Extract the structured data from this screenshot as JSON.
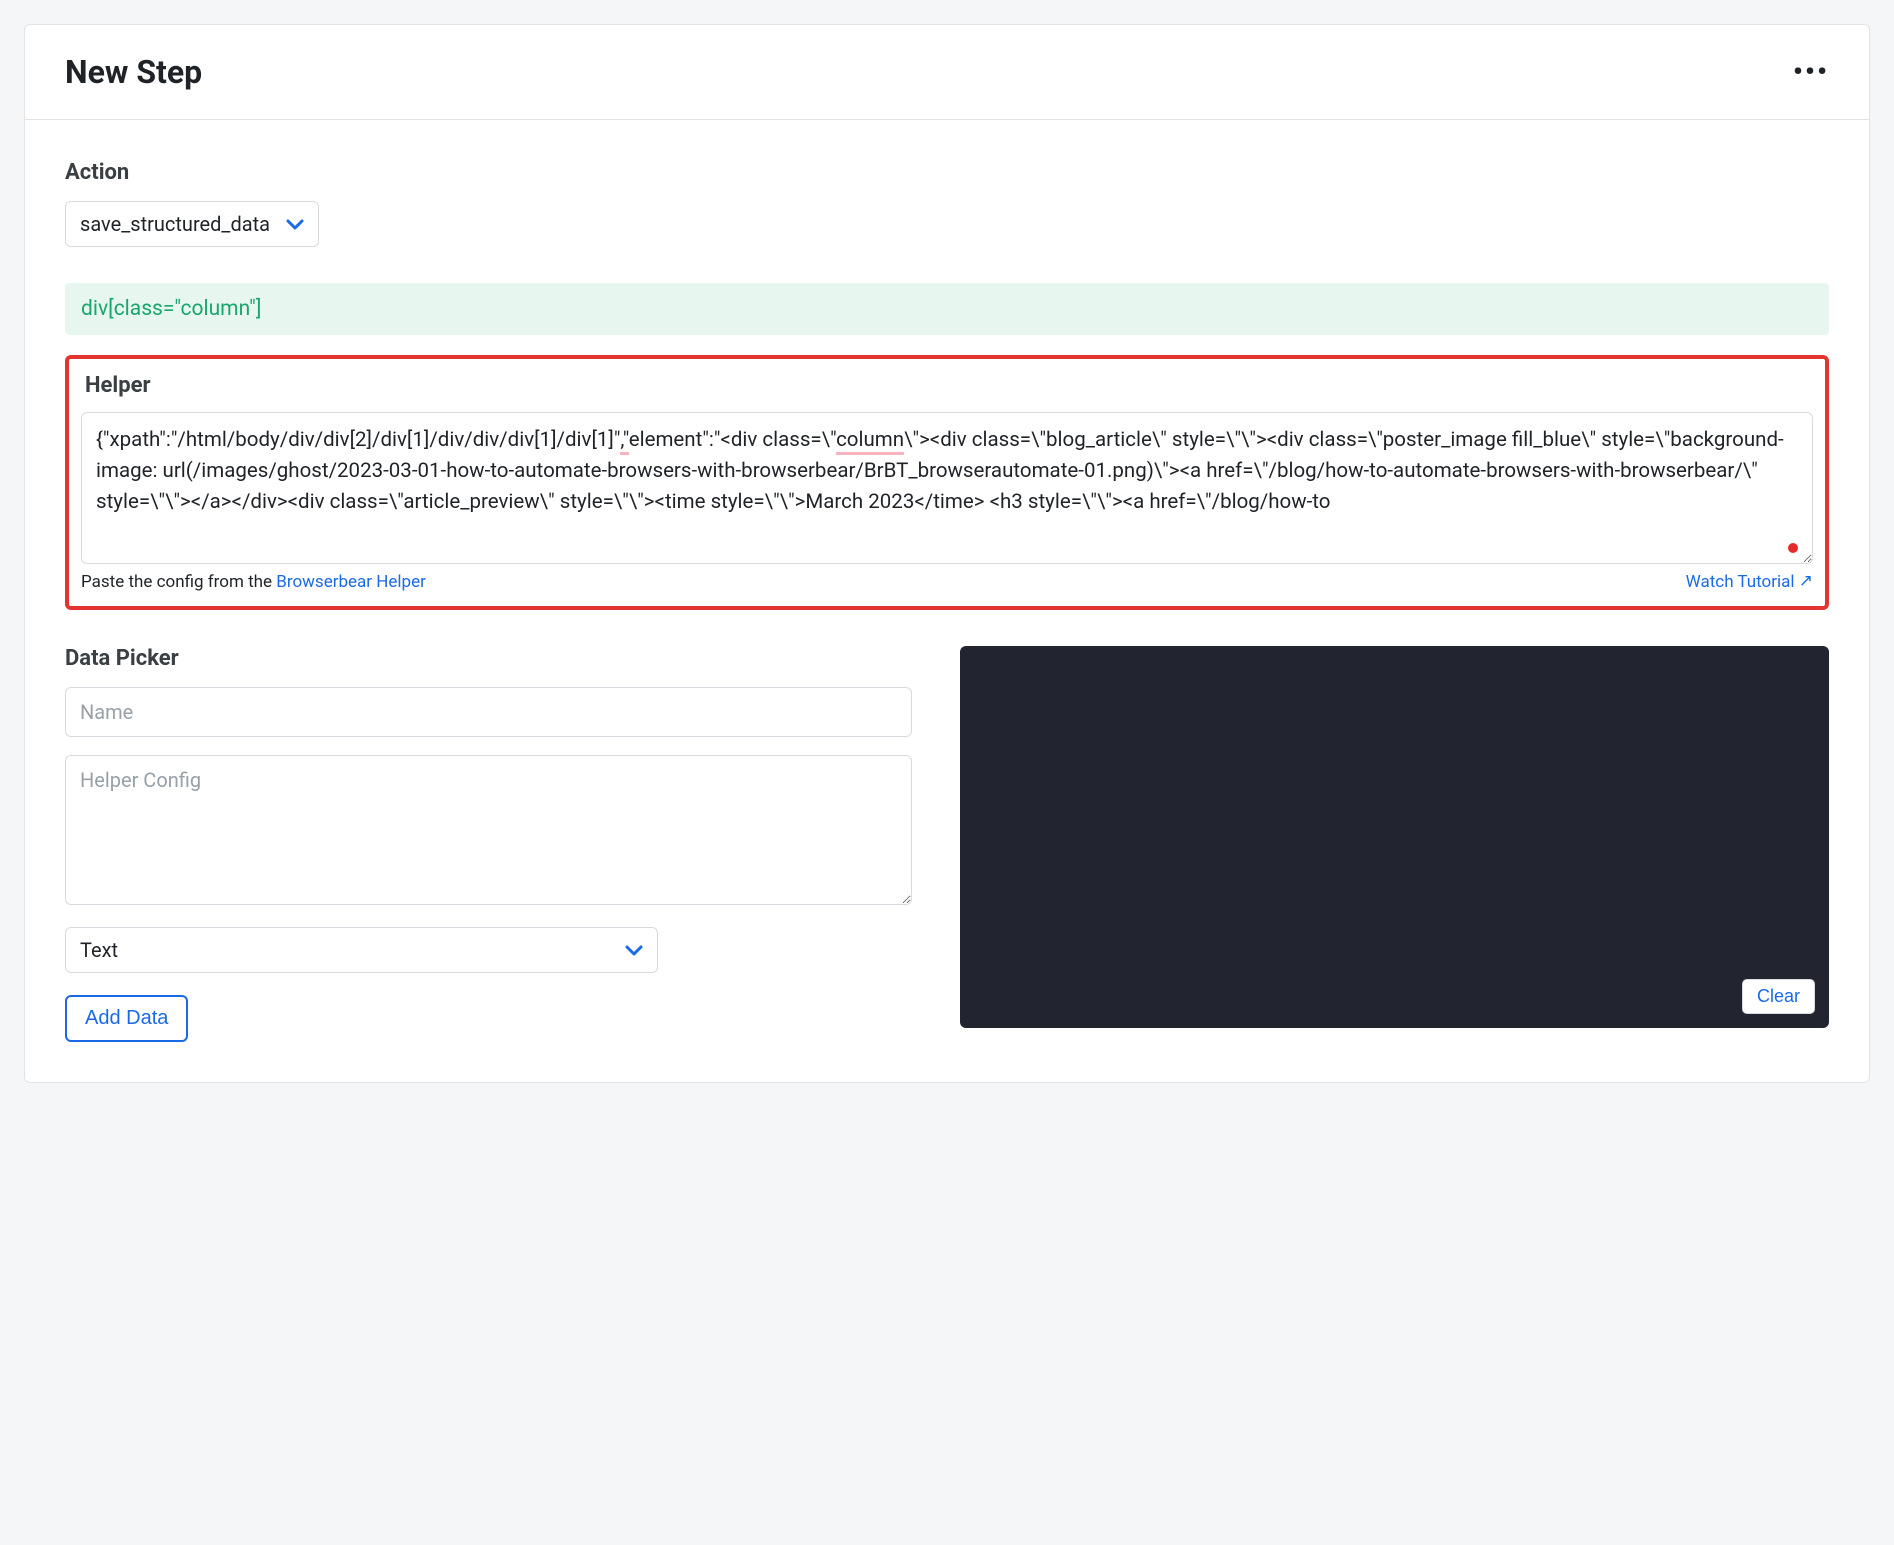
{
  "header": {
    "title": "New Step"
  },
  "action": {
    "label": "Action",
    "value": "save_structured_data"
  },
  "selector_chip": "div[class=\"column\"]",
  "helper": {
    "label": "Helper",
    "value": "{\"xpath\":\"/html/body/div/div[2]/div[1]/div/div/div[1]/div[1]\",\"element\":\"<div class=\\\"column\\\"><div class=\\\"blog_article\\\" style=\\\"\\\"><div class=\\\"poster_image fill_blue\\\" style=\\\"background-image: url(/images/ghost/2023-03-01-how-to-automate-browsers-with-browserbear/BrBT_browserautomate-01.png)\\\"><a href=\\\"/blog/how-to-automate-browsers-with-browserbear/\\\" style=\\\"\\\"></a></div><div class=\\\"article_preview\\\" style=\\\"\\\"><time style=\\\"\\\">March 2023</time> <h3 style=\\\"\\\"><a href=\\\"/blog/how-to",
    "hint_prefix": "Paste the config from the ",
    "hint_link": "Browserbear Helper",
    "watch_link": "Watch Tutorial"
  },
  "data_picker": {
    "label": "Data Picker",
    "name_placeholder": "Name",
    "config_placeholder": "Helper Config",
    "type_value": "Text",
    "add_button": "Add Data"
  },
  "preview": {
    "clear_button": "Clear"
  }
}
